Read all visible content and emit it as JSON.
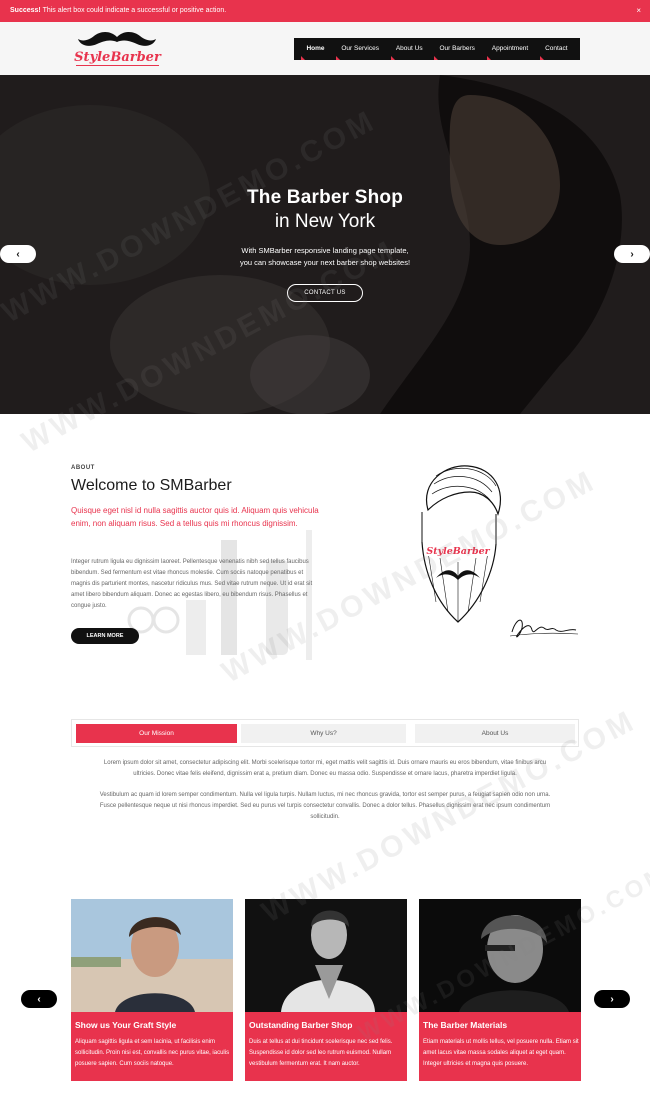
{
  "alert": {
    "strong": "Success!",
    "text": " This alert box could indicate a successful or positive action.",
    "close": "×"
  },
  "logo": {
    "text": "StyleBarber"
  },
  "nav": {
    "items": [
      "Home",
      "Our Services",
      "About Us",
      "Our Barbers",
      "Appointment",
      "Contact"
    ]
  },
  "hero": {
    "title": "The Barber Shop",
    "subtitle": "in New York",
    "desc_line1": "With SMBarber responsive landing page template,",
    "desc_line2": "you can showcase your next barber shop websites!",
    "button": "CONTACT US",
    "prev": "‹",
    "next": "›"
  },
  "about": {
    "label": "ABOUT",
    "title": "Welcome to SMBarber",
    "lead": "Quisque eget nisl id nulla sagittis auctor quis id. Aliquam quis vehicula enim, non aliquam risus. Sed a tellus quis mi rhoncus dignissim.",
    "body": "Integer rutrum ligula eu dignissim laoreet. Pellentesque venenatis nibh sed tellus faucibus bibendum. Sed fermentum est vitae rhoncus molestie. Cum sociis natoque penatibus et magnis dis parturient montes, nascetur ridiculus mus. Sed vitae rutrum neque. Ut id erat sit amet libero bibendum aliquam. Donec ac egestas libero, eu bibendum risus. Phasellus et congue justo.",
    "button": "LEARN MORE",
    "badge": "StyleBarber"
  },
  "tabs": {
    "items": [
      "Our Mission",
      "Why Us?",
      "About Us"
    ],
    "p1_line1": "Lorem ipsum dolor sit amet, consectetur adipiscing elit. Morbi scelerisque tortor mi, eget mattis velit sagittis id. Duis ornare mauris eu eros bibendum, vitae finibus arcu",
    "p1_line2": "ultricies. Donec vitae felis eleifend, dignissim erat a, pretium diam. Donec eu massa odio. Suspendisse et ornare lacus, pharetra imperdiet ligula.",
    "p2_line1": "Vestibulum ac quam id lorem semper condimentum. Nulla vel ligula turpis. Nullam luctus, mi nec rhoncus gravida, tortor est semper purus, a feugiat sapien odio non urna.",
    "p2_line2": "Fusce pellentesque neque ut nisi rhoncus imperdiet. Sed eu purus vel turpis consectetur convallis. Donec a dolor tellus. Phasellus dignissim erat nec ipsum condimentum",
    "p2_line3": "sollicitudin."
  },
  "cards": [
    {
      "title": "Show us Your Graft Style",
      "text": "Aliquam sagittis ligula et sem lacinia, ut facilisis enim sollicitudin. Proin nisi est, convallis nec purus vitae, iaculis posuere sapien. Cum sociis natoque."
    },
    {
      "title": "Outstanding Barber Shop",
      "text": "Duis at tellus at dui tincidunt scelerisque nec sed felis. Suspendisse id dolor sed leo rutrum euismod. Nullam vestibulum fermentum erat. It nam auctor."
    },
    {
      "title": "The Barber Materials",
      "text": "Etiam materials ut mollis tellus, vel posuere nulla. Etiam sit amet lacus vitae massa sodales aliquet at eget quam. Integer ultricies et magna quis posuere."
    }
  ],
  "carousel": {
    "prev": "‹",
    "next": "›"
  },
  "watermark": "WWW.DOWNDEMO.COM",
  "colors": {
    "accent": "#e8334d",
    "dark": "#111111",
    "header_bg": "#f6f6f6"
  }
}
